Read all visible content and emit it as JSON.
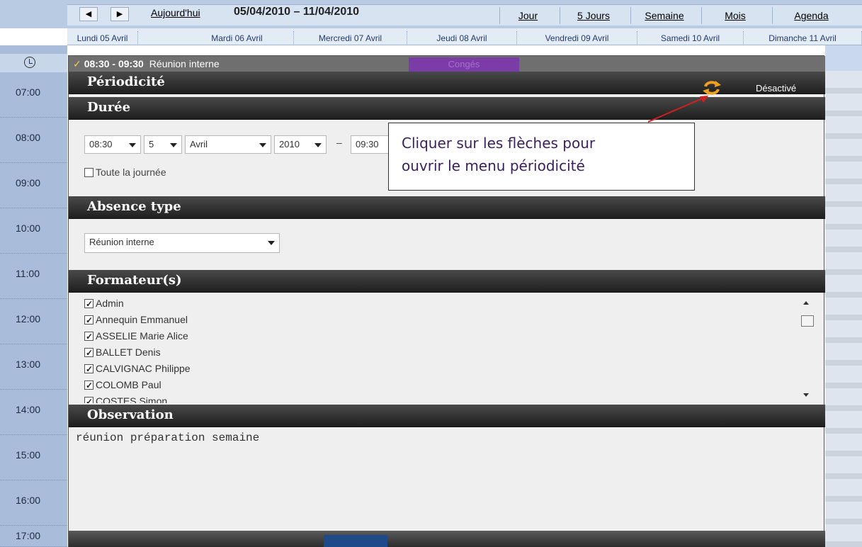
{
  "toolbar": {
    "prev_icon": "◀",
    "next_icon": "▶",
    "today_label": "Aujourd'hui",
    "date_range": "05/04/2010 – 11/04/2010",
    "views": [
      "Jour",
      "5 Jours",
      "Semaine",
      "Mois",
      "Agenda"
    ]
  },
  "days": [
    "Lundi 05 Avril",
    "Mardi 06 Avril",
    "Mercredi 07 Avril",
    "Jeudi 08 Avril",
    "Vendredi 09 Avril",
    "Samedi 10 Avril",
    "Dimanche 11 Avril"
  ],
  "hours": [
    "07:00",
    "08:00",
    "09:00",
    "10:00",
    "11:00",
    "12:00",
    "13:00",
    "14:00",
    "15:00",
    "16:00",
    "17:00"
  ],
  "event": {
    "time": "08:30 - 09:30",
    "title": "Réunion interne",
    "category": "Congés"
  },
  "sections": {
    "periodicite": "Périodicité",
    "periodicite_status": "Désactivé",
    "duree": "Durée",
    "absence_type": "Absence type",
    "formateurs": "Formateur(s)",
    "observation": "Observation"
  },
  "duration": {
    "start_time": "08:30",
    "day": "5",
    "month": "Avril",
    "year": "2010",
    "separator": "–",
    "end_time": "09:30",
    "all_day_label": "Toute la journée"
  },
  "absence_type_value": "Réunion interne",
  "trainers": [
    "Admin",
    "Annequin Emmanuel",
    "ASSELIE Marie Alice",
    "BALLET Denis",
    "CALVIGNAC Philippe",
    "COLOMB Paul",
    "COSTES Simon"
  ],
  "observation_text": "réunion préparation semaine",
  "callout": {
    "line1": "Cliquer sur les flèches pour",
    "line2": "ouvrir le menu périodicité"
  },
  "colors": {
    "accent_purple": "#7c3ca8",
    "header_dark": "#1f1f1f",
    "time_column": "#a9bddb",
    "recurrence_icon": "#f0a020",
    "arrow": "#d02020"
  }
}
